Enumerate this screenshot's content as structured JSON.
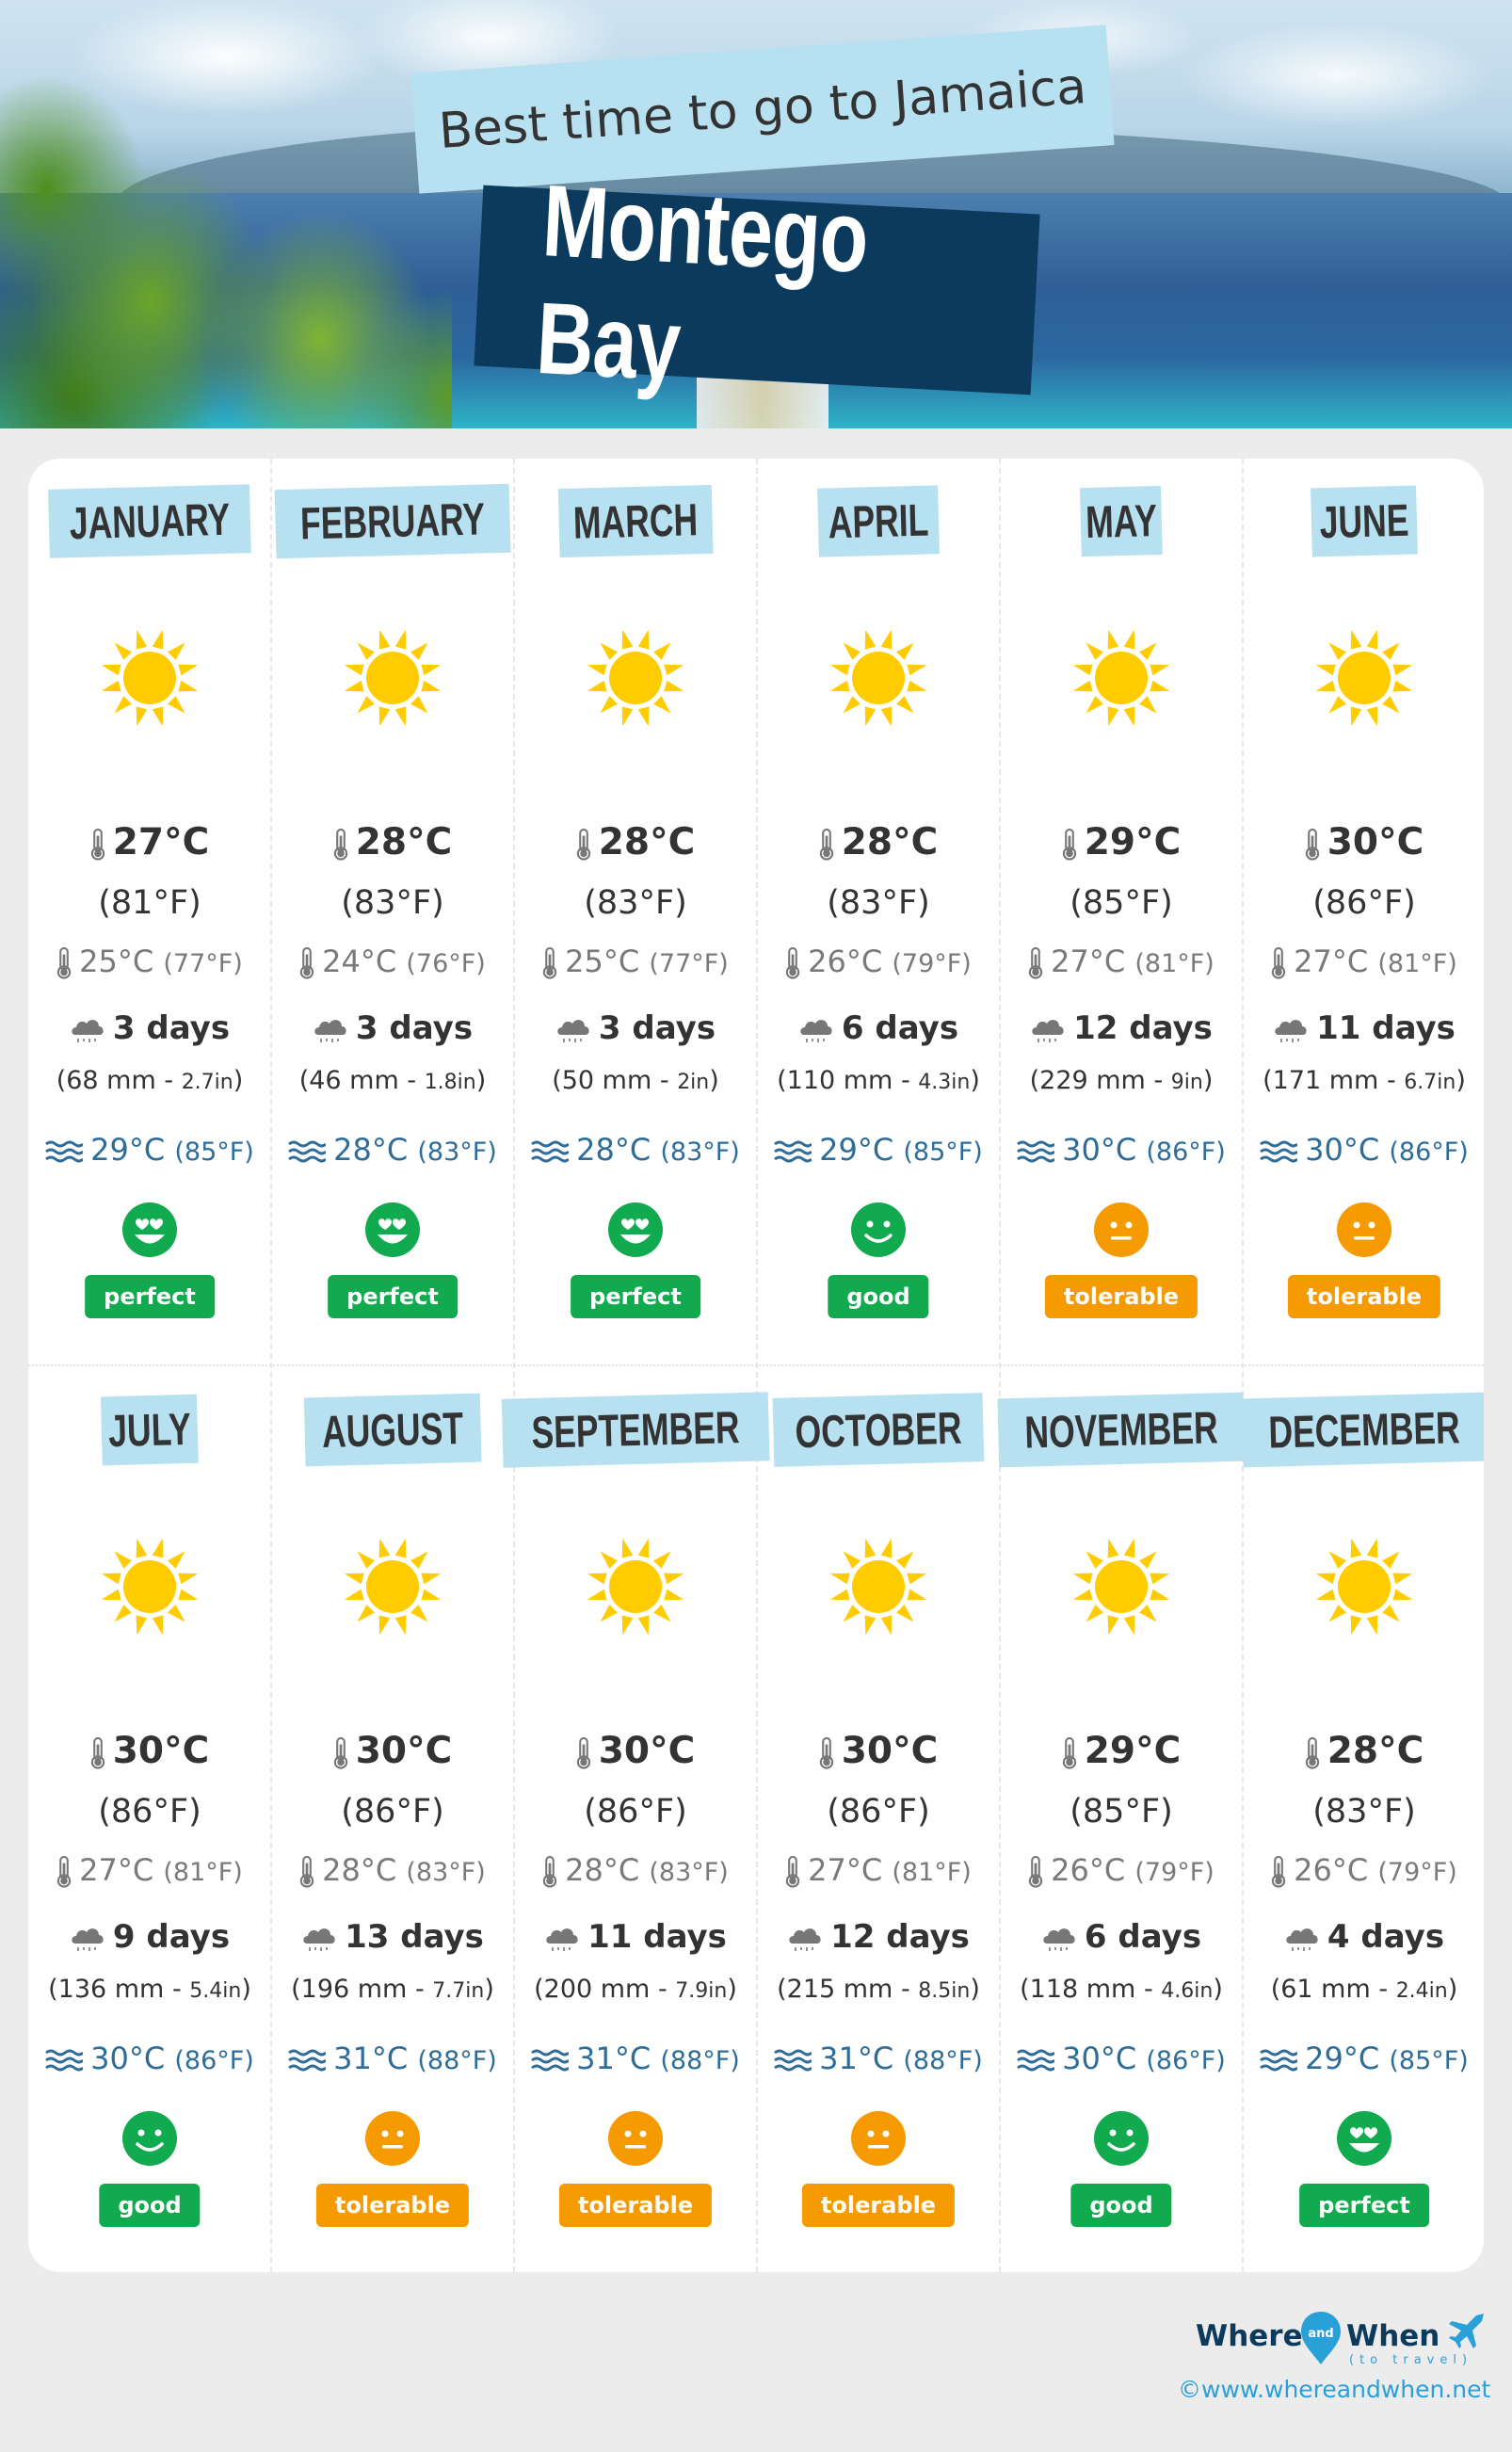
{
  "header": {
    "subtitle": "Best time to go to Jamaica",
    "title": "Montego Bay"
  },
  "colors": {
    "month_label_bg": "#b7e0f1",
    "title_bg": "#0c3a5c",
    "perfect": "#11aa4e",
    "good": "#11aa4e",
    "tolerable": "#f59a00",
    "sea_text": "#2e6d99",
    "sun": "#ffcc00"
  },
  "months": [
    {
      "name": "JANUARY",
      "weather": "sun-icon",
      "temp_c": "27°C",
      "temp_f": "(81°F)",
      "min_c": "25°C",
      "min_f": "(77°F)",
      "rain_days": "3 days",
      "rain_mm": "(68 mm - ",
      "rain_in": "2.7in",
      "rain_close": ")",
      "sea_c": "29°C",
      "sea_f": "(85°F)",
      "rating": "perfect"
    },
    {
      "name": "FEBRUARY",
      "weather": "sun-icon",
      "temp_c": "28°C",
      "temp_f": "(83°F)",
      "min_c": "24°C",
      "min_f": "(76°F)",
      "rain_days": "3 days",
      "rain_mm": "(46 mm - ",
      "rain_in": "1.8in",
      "rain_close": ")",
      "sea_c": "28°C",
      "sea_f": "(83°F)",
      "rating": "perfect"
    },
    {
      "name": "MARCH",
      "weather": "sun-icon",
      "temp_c": "28°C",
      "temp_f": "(83°F)",
      "min_c": "25°C",
      "min_f": "(77°F)",
      "rain_days": "3 days",
      "rain_mm": "(50 mm - ",
      "rain_in": "2in",
      "rain_close": ")",
      "sea_c": "28°C",
      "sea_f": "(83°F)",
      "rating": "perfect"
    },
    {
      "name": "APRIL",
      "weather": "sun-icon",
      "temp_c": "28°C",
      "temp_f": "(83°F)",
      "min_c": "26°C",
      "min_f": "(79°F)",
      "rain_days": "6 days",
      "rain_mm": "(110 mm - ",
      "rain_in": "4.3in",
      "rain_close": ")",
      "sea_c": "29°C",
      "sea_f": "(85°F)",
      "rating": "good"
    },
    {
      "name": "MAY",
      "weather": "sun-icon",
      "temp_c": "29°C",
      "temp_f": "(85°F)",
      "min_c": "27°C",
      "min_f": "(81°F)",
      "rain_days": "12 days",
      "rain_mm": "(229 mm - ",
      "rain_in": "9in",
      "rain_close": ")",
      "sea_c": "30°C",
      "sea_f": "(86°F)",
      "rating": "tolerable"
    },
    {
      "name": "JUNE",
      "weather": "sun-icon",
      "temp_c": "30°C",
      "temp_f": "(86°F)",
      "min_c": "27°C",
      "min_f": "(81°F)",
      "rain_days": "11 days",
      "rain_mm": "(171 mm - ",
      "rain_in": "6.7in",
      "rain_close": ")",
      "sea_c": "30°C",
      "sea_f": "(86°F)",
      "rating": "tolerable"
    },
    {
      "name": "JULY",
      "weather": "sun-icon",
      "temp_c": "30°C",
      "temp_f": "(86°F)",
      "min_c": "27°C",
      "min_f": "(81°F)",
      "rain_days": "9 days",
      "rain_mm": "(136 mm - ",
      "rain_in": "5.4in",
      "rain_close": ")",
      "sea_c": "30°C",
      "sea_f": "(86°F)",
      "rating": "good"
    },
    {
      "name": "AUGUST",
      "weather": "sun-icon",
      "temp_c": "30°C",
      "temp_f": "(86°F)",
      "min_c": "28°C",
      "min_f": "(83°F)",
      "rain_days": "13 days",
      "rain_mm": "(196 mm - ",
      "rain_in": "7.7in",
      "rain_close": ")",
      "sea_c": "31°C",
      "sea_f": "(88°F)",
      "rating": "tolerable"
    },
    {
      "name": "SEPTEMBER",
      "weather": "sun-icon",
      "temp_c": "30°C",
      "temp_f": "(86°F)",
      "min_c": "28°C",
      "min_f": "(83°F)",
      "rain_days": "11 days",
      "rain_mm": "(200 mm - ",
      "rain_in": "7.9in",
      "rain_close": ")",
      "sea_c": "31°C",
      "sea_f": "(88°F)",
      "rating": "tolerable"
    },
    {
      "name": "OCTOBER",
      "weather": "sun-icon",
      "temp_c": "30°C",
      "temp_f": "(86°F)",
      "min_c": "27°C",
      "min_f": "(81°F)",
      "rain_days": "12 days",
      "rain_mm": "(215 mm - ",
      "rain_in": "8.5in",
      "rain_close": ")",
      "sea_c": "31°C",
      "sea_f": "(88°F)",
      "rating": "tolerable"
    },
    {
      "name": "NOVEMBER",
      "weather": "sun-icon",
      "temp_c": "29°C",
      "temp_f": "(85°F)",
      "min_c": "26°C",
      "min_f": "(79°F)",
      "rain_days": "6 days",
      "rain_mm": "(118 mm - ",
      "rain_in": "4.6in",
      "rain_close": ")",
      "sea_c": "30°C",
      "sea_f": "(86°F)",
      "rating": "good"
    },
    {
      "name": "DECEMBER",
      "weather": "sun-icon",
      "temp_c": "28°C",
      "temp_f": "(83°F)",
      "min_c": "26°C",
      "min_f": "(79°F)",
      "rain_days": "4 days",
      "rain_mm": "(61 mm - ",
      "rain_in": "2.4in",
      "rain_close": ")",
      "sea_c": "29°C",
      "sea_f": "(85°F)",
      "rating": "perfect"
    }
  ],
  "ratings": {
    "perfect": {
      "label": "perfect",
      "face": "heart-eyes-face-icon"
    },
    "good": {
      "label": "good",
      "face": "smiley-face-icon"
    },
    "tolerable": {
      "label": "tolerable",
      "face": "neutral-face-icon"
    }
  },
  "footer": {
    "logo_where": "Where",
    "logo_and": "and",
    "logo_when": "When",
    "logo_tagline": "(to travel)",
    "copyright": "©www.whereandwhen.net"
  }
}
